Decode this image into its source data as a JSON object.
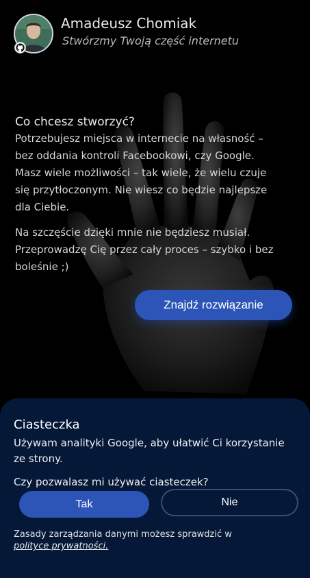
{
  "header": {
    "name": "Amadeusz Chomiak",
    "tagline": "Stwórzmy Twoją część internetu"
  },
  "intro": {
    "heading": "Co chcesz stworzyć?",
    "paragraph1": "Potrzebujesz miejsca w internecie na własność – bez oddania kontroli Facebookowi, czy Google. Masz wiele możliwości – tak wiele, że wielu czuje się przytłoczonym. Nie wiesz co będzie najlepsze dla Ciebie.",
    "paragraph2": "Na szczęście dzięki mnie nie będziesz musiał. Przeprowadzę Cię przez cały proces – szybko i bez boleśnie ;)",
    "cta_label": "Znajdź rozwiązanie"
  },
  "cookie": {
    "title": "Ciasteczka",
    "text": "Używam analityki Google, aby ułatwić Ci korzystanie ze strony.",
    "question": "Czy pozwalasz mi używać ciasteczek?",
    "accept_label": "Tak",
    "decline_label": "Nie",
    "footer_text": "Zasady zarządzania danymi możesz sprawdzić w",
    "footer_link": "polityce prywatności."
  },
  "colors": {
    "background": "#000000",
    "accent": "#2c55b7",
    "cookie_panel": "#061838"
  },
  "icons": {
    "avatar": "user-photo",
    "badge": "github-icon"
  }
}
